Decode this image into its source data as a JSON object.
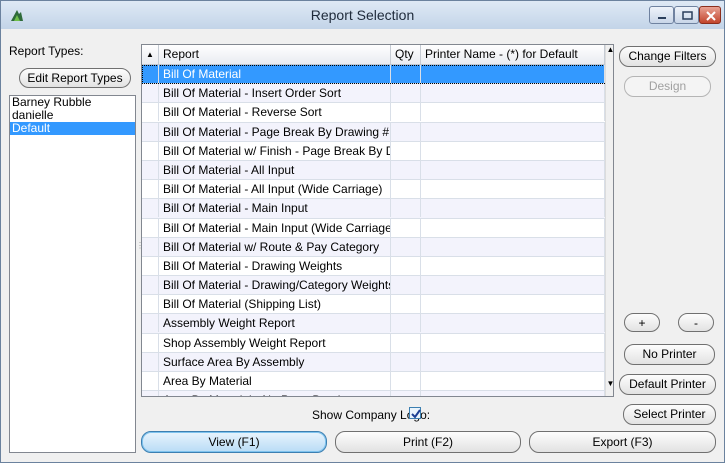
{
  "window": {
    "title": "Report Selection"
  },
  "left": {
    "report_types_label": "Report Types:",
    "edit_button": "Edit Report Types",
    "types": [
      "Barney Rubble",
      "danielle",
      "Default"
    ],
    "selected_type": "Default"
  },
  "grid": {
    "columns": {
      "sort": "▲",
      "report": "Report",
      "qty": "Qty",
      "printer": "Printer Name - (*) for Default"
    },
    "rows": [
      "Bill Of Material",
      "Bill Of Material - Insert Order Sort",
      "Bill Of Material - Reverse Sort",
      "Bill Of Material - Page Break By Drawing #",
      "Bill Of Material w/ Finish - Page Break By D",
      "Bill Of Material - All Input",
      "Bill Of Material - All Input (Wide Carriage)",
      "Bill Of Material - Main Input",
      "Bill Of Material - Main Input (Wide Carriage)",
      "Bill Of Material w/ Route & Pay Category",
      "Bill Of Material - Drawing Weights",
      "Bill Of Material - Drawing/Category Weights",
      "Bill Of Material (Shipping List)",
      "Assembly Weight Report",
      "Shop Assembly Weight Report",
      "Surface Area By Assembly",
      "Area By Material",
      "Area By Material - No Page Break"
    ],
    "selected_row": "Bill Of Material"
  },
  "right": {
    "change_filters": "Change Filters",
    "design": "Design",
    "plus": "+",
    "minus": "-",
    "no_printer": "No Printer",
    "default_printer": "Default Printer",
    "select_printer": "Select Printer"
  },
  "bottom": {
    "show_logo_label": "Show Company Logo:",
    "show_logo_checked": true,
    "view": "View (F1)",
    "print": "Print (F2)",
    "export": "Export (F3)"
  },
  "colors": {
    "selection": "#3399ff",
    "accent": "#3c7fb1"
  }
}
